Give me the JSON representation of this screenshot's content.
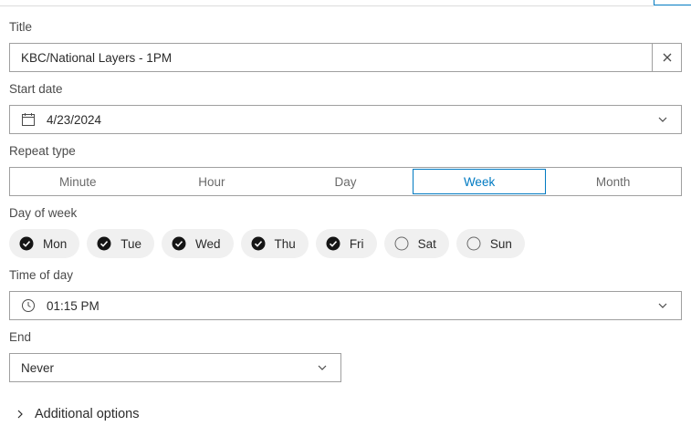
{
  "title_field": {
    "label": "Title",
    "value": "KBC/National Layers - 1PM"
  },
  "start_date": {
    "label": "Start date",
    "value": "4/23/2024"
  },
  "repeat_type": {
    "label": "Repeat type",
    "options": [
      "Minute",
      "Hour",
      "Day",
      "Week",
      "Month"
    ],
    "selected": "Week"
  },
  "day_of_week": {
    "label": "Day of week",
    "days": [
      {
        "label": "Mon",
        "checked": true
      },
      {
        "label": "Tue",
        "checked": true
      },
      {
        "label": "Wed",
        "checked": true
      },
      {
        "label": "Thu",
        "checked": true
      },
      {
        "label": "Fri",
        "checked": true
      },
      {
        "label": "Sat",
        "checked": false
      },
      {
        "label": "Sun",
        "checked": false
      }
    ]
  },
  "time_of_day": {
    "label": "Time of day",
    "value": "01:15 PM"
  },
  "end": {
    "label": "End",
    "value": "Never"
  },
  "additional_options": {
    "label": "Additional options"
  },
  "colors": {
    "accent": "#007ac2",
    "border": "#9f9f9f",
    "chip_bg": "#f0f0f0"
  }
}
